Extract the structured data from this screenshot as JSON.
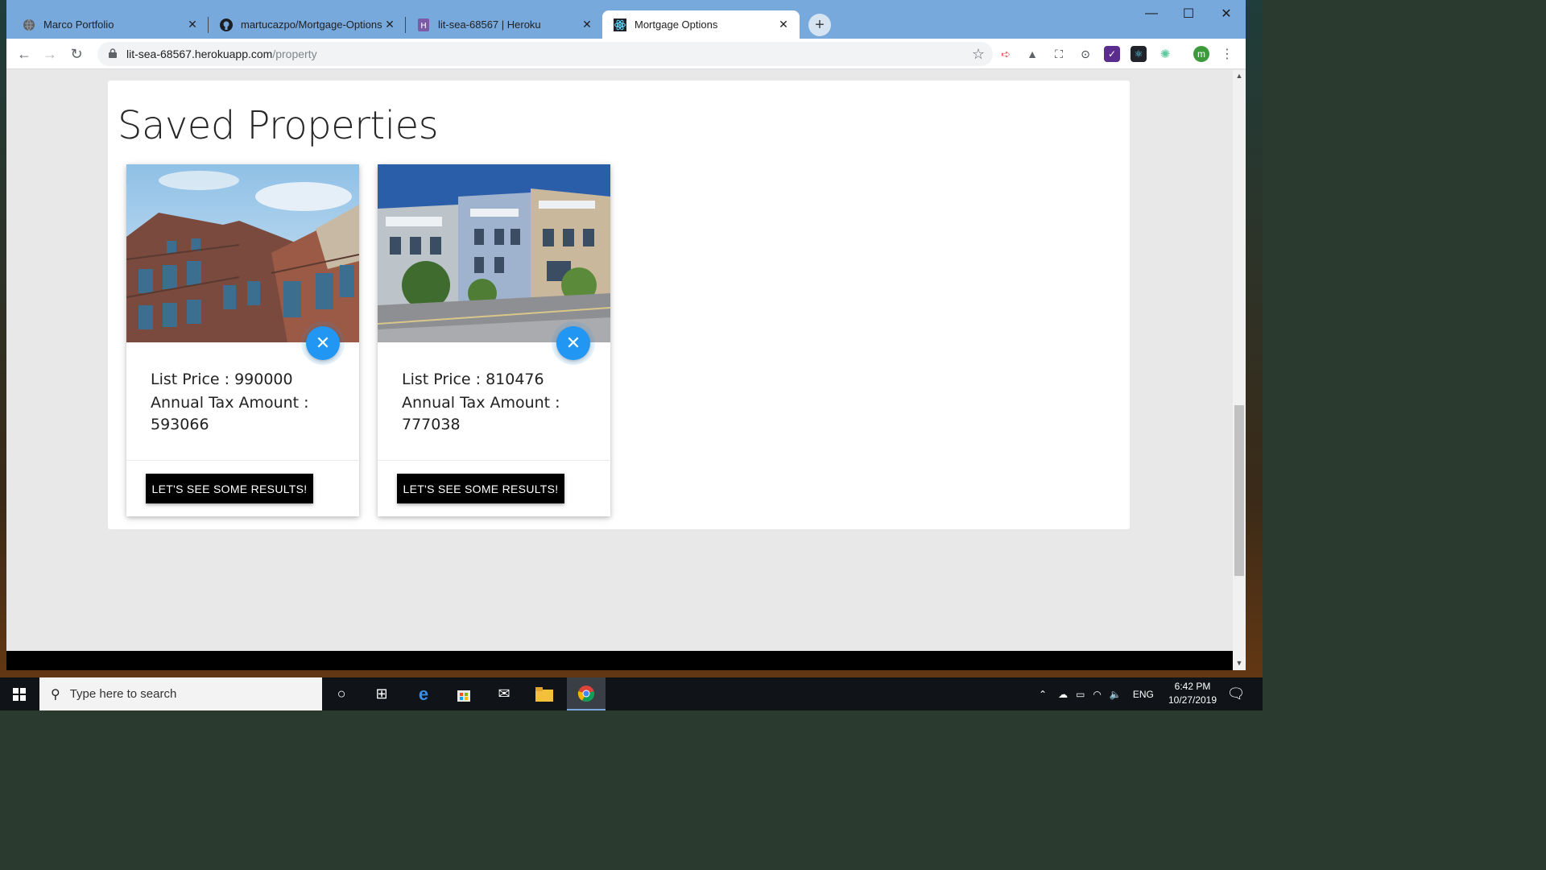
{
  "browser": {
    "tabs": [
      {
        "label": "Marco Portfolio",
        "icon": "globe-icon"
      },
      {
        "label": "martucazpo/Mortgage-Options",
        "icon": "github-icon"
      },
      {
        "label": "lit-sea-68567 | Heroku",
        "icon": "heroku-icon"
      },
      {
        "label": "Mortgage Options",
        "icon": "react-icon",
        "active": true
      }
    ],
    "url_host": "lit-sea-68567.herokuapp.com",
    "url_path": "/property",
    "profile_initial": "m"
  },
  "page": {
    "heading": "Saved Properties",
    "cards": [
      {
        "image": "brownstone-building-photo",
        "list_price": "List Price : 990000",
        "tax_label": "Annual Tax Amount :",
        "tax_value": "593066",
        "action_label": "LET'S SEE SOME RESULTS!"
      },
      {
        "image": "victorian-houses-photo",
        "list_price": "List Price : 810476",
        "tax_label": "Annual Tax Amount :",
        "tax_value": "777038",
        "action_label": "LET'S SEE SOME RESULTS!"
      }
    ]
  },
  "taskbar": {
    "search_placeholder": "Type here to search",
    "language": "ENG",
    "time": "6:42 PM",
    "date": "10/27/2019"
  },
  "colors": {
    "tabbar": "#78a9dc",
    "fab_blue": "#2196f3",
    "button_black": "#000000"
  }
}
